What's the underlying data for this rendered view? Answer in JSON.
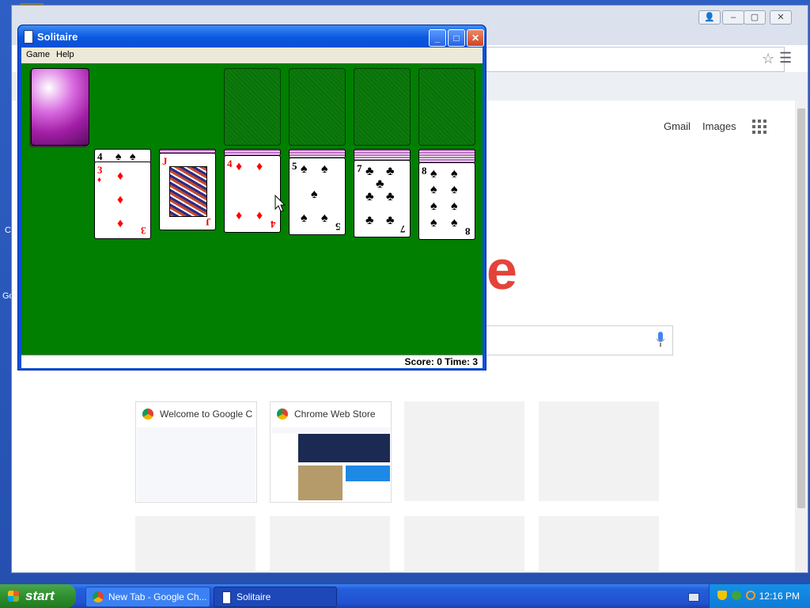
{
  "desktop": {
    "icon_letters": [
      "C",
      "Go"
    ]
  },
  "chrome": {
    "window_controls": [
      "person",
      "minimize",
      "maximize",
      "close"
    ],
    "links": {
      "gmail": "Gmail",
      "images": "Images"
    },
    "logo_fragment": "e",
    "tiles": [
      {
        "title": "Welcome to Google C"
      },
      {
        "title": "Chrome Web Store"
      }
    ]
  },
  "solitaire": {
    "title": "Solitaire",
    "menu": {
      "game": "Game",
      "help": "Help"
    },
    "status": "Score: 0 Time: 3",
    "tableau": [
      {
        "ranks": [
          "4",
          "3"
        ],
        "suit": "♦",
        "color": "red"
      },
      {
        "ranks": [
          "J"
        ],
        "suit": "♦",
        "color": "red"
      },
      {
        "ranks": [
          "4"
        ],
        "suit": "♦",
        "color": "red"
      },
      {
        "ranks": [
          "5"
        ],
        "suit": "♠",
        "color": "black"
      },
      {
        "ranks": [
          "7"
        ],
        "suit": "♣",
        "color": "black"
      },
      {
        "ranks": [
          "8"
        ],
        "suit": "♠",
        "color": "black"
      }
    ]
  },
  "taskbar": {
    "start": "start",
    "tasks": [
      {
        "label": "New Tab - Google Ch..."
      },
      {
        "label": "Solitaire"
      }
    ],
    "clock": "12:16 PM"
  }
}
